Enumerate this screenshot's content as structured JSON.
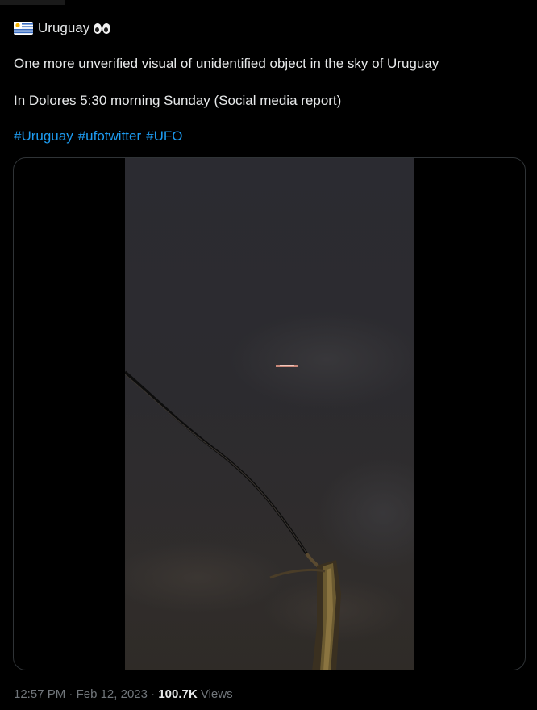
{
  "tweet": {
    "title_text": "Uruguay",
    "title_emoji_icon": "eyes-emoji-icon",
    "flag_icon": "uruguay-flag-icon",
    "body_line1": "One more unverified visual of unidentified object in the sky of Uruguay",
    "body_line2": "In Dolores 5:30 morning Sunday (Social media report)",
    "hashtags": [
      "#Uruguay",
      "#ufotwitter",
      "#UFO"
    ],
    "hashtag_color": "#1d9bf0"
  },
  "meta": {
    "time": "12:57 PM",
    "separator1": " · ",
    "date": "Feb 12, 2023",
    "separator2": " · ",
    "views_count": "100.7K",
    "views_label": " Views"
  },
  "colors": {
    "background": "#000000",
    "text": "#e7e9ea",
    "muted": "#71767b",
    "border": "#2f3336",
    "video_sky": "#2a2a2e"
  }
}
